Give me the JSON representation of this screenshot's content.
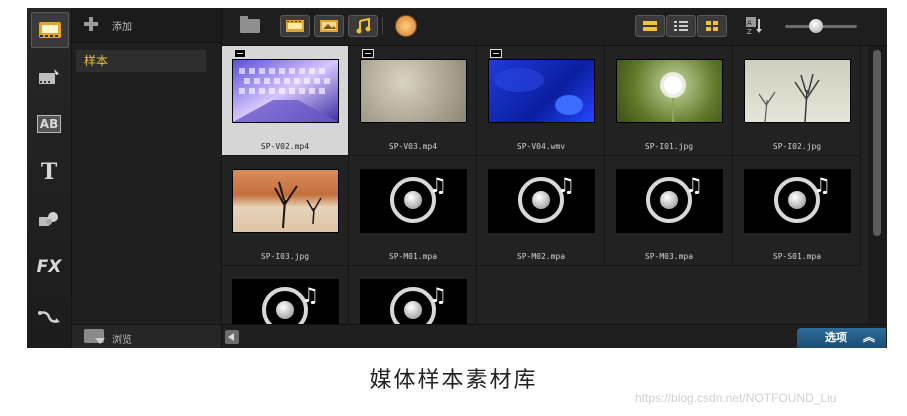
{
  "library": {
    "add_label": "添加",
    "items": [
      "样本"
    ],
    "browse_label": "浏览"
  },
  "rail": {
    "buttons": [
      {
        "name": "media-icon",
        "label": "",
        "active": true
      },
      {
        "name": "instant-project-icon",
        "label": ""
      },
      {
        "name": "transition-icon",
        "label": "AB"
      },
      {
        "name": "title-icon",
        "label": "T"
      },
      {
        "name": "graphic-icon",
        "label": ""
      },
      {
        "name": "filter-icon",
        "label": "FX"
      },
      {
        "name": "path-icon",
        "label": ""
      }
    ]
  },
  "toolbar": {
    "icons": [
      "folder-icon",
      "video-filter-icon",
      "photo-filter-icon",
      "audio-filter-icon",
      "fx-color-icon",
      "thumbnail-strip-icon",
      "list-view-icon",
      "grid-view-icon",
      "sort-icon"
    ]
  },
  "grid": {
    "items": [
      {
        "name": "SP-V02.mp4",
        "type": "video",
        "selected": true
      },
      {
        "name": "SP-V03.mp4",
        "type": "video"
      },
      {
        "name": "SP-V04.wmv",
        "type": "video"
      },
      {
        "name": "SP-I01.jpg",
        "type": "image"
      },
      {
        "name": "SP-I02.jpg",
        "type": "image"
      },
      {
        "name": "SP-I03.jpg",
        "type": "image"
      },
      {
        "name": "SP-M01.mpa",
        "type": "audio"
      },
      {
        "name": "SP-M02.mpa",
        "type": "audio"
      },
      {
        "name": "SP-M03.mpa",
        "type": "audio"
      },
      {
        "name": "SP-S01.mpa",
        "type": "audio"
      },
      {
        "name": "",
        "type": "audio"
      },
      {
        "name": "",
        "type": "audio"
      }
    ]
  },
  "bottom": {
    "options_label": "选项",
    "options_chevron": "︽"
  },
  "caption": "媒体样本素材库",
  "watermark": "https://blog.csdn.net/NOTFOUND_Liu",
  "colors": {
    "selected_folder": "#e8c23a",
    "options_button": "#2d6d9a",
    "selected_cell": "#d6d6d6"
  }
}
